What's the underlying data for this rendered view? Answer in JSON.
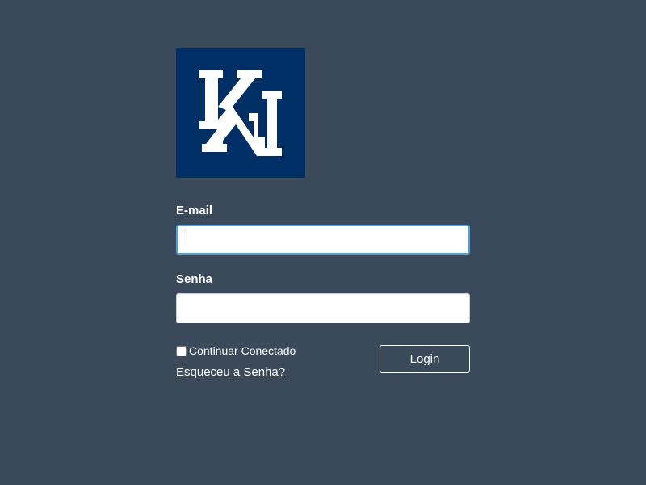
{
  "logo": {
    "icon": "ka-monogram-logo",
    "bg_color": "#002f66"
  },
  "form": {
    "email_label": "E-mail",
    "email_value": "",
    "password_label": "Senha",
    "password_value": "",
    "remember_label": "Continuar Conectado",
    "remember_checked": false,
    "forgot_link": "Esqueceu a Senha?",
    "login_button": "Login"
  },
  "colors": {
    "background": "#3a4a5a",
    "focus_border": "#4aa3e0"
  }
}
